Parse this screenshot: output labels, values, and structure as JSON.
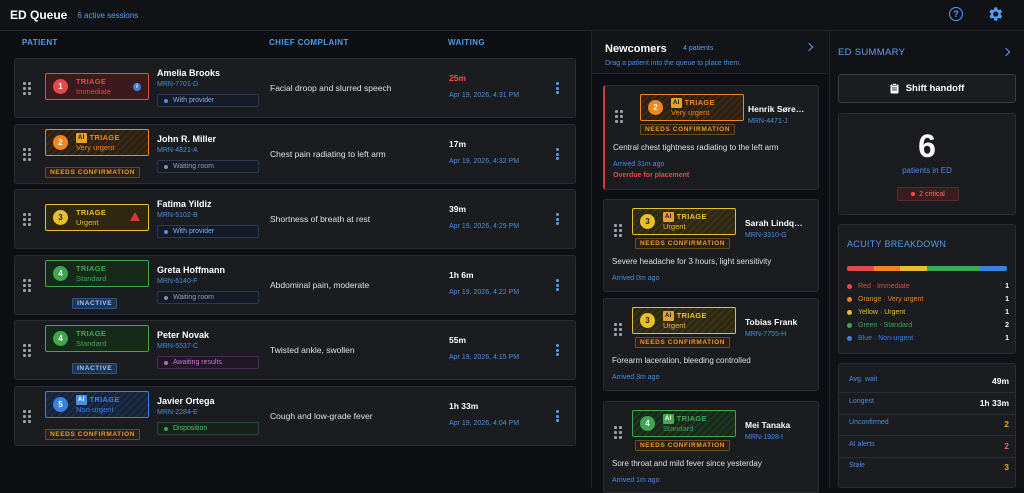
{
  "header": {
    "title": "ED Queue",
    "sessions": "6 active sessions"
  },
  "columns": {
    "patient": "PATIENT",
    "complaint": "CHIEF COMPLAINT",
    "waiting": "WAITING"
  },
  "queue": [
    {
      "triage_num": "1",
      "triage_label": "TRIAGE",
      "triage_level": "Immediate",
      "ai": false,
      "flag": "",
      "name": "Amelia Brooks",
      "mrn": "MRN-7701-D",
      "status": "With provider",
      "complaint": "Facial droop and slurred speech",
      "wait": "25m",
      "date": "Apr 19, 2026, 4:31 PM"
    },
    {
      "triage_num": "2",
      "triage_label": "TRIAGE",
      "triage_level": "Very urgent",
      "ai": true,
      "ai_text": "AI",
      "flag": "NEEDS CONFIRMATION",
      "name": "John R. Miller",
      "mrn": "MRN-4821-A",
      "status": "Waiting room",
      "complaint": "Chest pain radiating to left arm",
      "wait": "17m",
      "date": "Apr 19, 2026, 4:32 PM"
    },
    {
      "triage_num": "3",
      "triage_label": "TRIAGE",
      "triage_level": "Urgent",
      "ai": false,
      "flag": "",
      "name": "Fatima Yildiz",
      "mrn": "MRN-5102-B",
      "status": "With provider",
      "complaint": "Shortness of breath at rest",
      "wait": "39m",
      "date": "Apr 19, 2026, 4:29 PM"
    },
    {
      "triage_num": "4",
      "triage_label": "TRIAGE",
      "triage_level": "Standard",
      "ai": false,
      "flag": "INACTIVE",
      "name": "Greta Hoffmann",
      "mrn": "MRN-6140-F",
      "status": "Waiting room",
      "complaint": "Abdominal pain, moderate",
      "wait": "1h 6m",
      "date": "Apr 19, 2026, 4:22 PM"
    },
    {
      "triage_num": "4",
      "triage_label": "TRIAGE",
      "triage_level": "Standard",
      "ai": false,
      "flag": "INACTIVE",
      "name": "Peter Novak",
      "mrn": "MRN-5537-C",
      "status": "Awaiting results",
      "complaint": "Twisted ankle, swollen",
      "wait": "55m",
      "date": "Apr 19, 2026, 4:15 PM"
    },
    {
      "triage_num": "5",
      "triage_label": "TRIAGE",
      "triage_level": "Non-urgent",
      "ai": true,
      "ai_text": "AI",
      "flag": "NEEDS CONFIRMATION",
      "name": "Javier Ortega",
      "mrn": "MRN-2284-E",
      "status": "Disposition",
      "complaint": "Cough and low-grade fever",
      "wait": "1h 33m",
      "date": "Apr 19, 2026, 4:04 PM"
    }
  ],
  "newcomers": {
    "title": "Newcomers",
    "count": "4 patients",
    "subtitle": "Drag a patient into the queue to place them.",
    "items": [
      {
        "num": "2",
        "ai_text": "AI",
        "label": "TRIAGE",
        "level": "Very urgent",
        "flag": "NEEDS CONFIRMATION",
        "name": "Henrik Søre…",
        "mrn": "MRN-4471-J",
        "complaint": "Central chest tightness radiating to the left arm",
        "arrived": "Arrived 31m ago",
        "overdue": "Overdue for placement"
      },
      {
        "num": "3",
        "ai_text": "AI",
        "label": "TRIAGE",
        "level": "Urgent",
        "flag": "NEEDS CONFIRMATION",
        "name": "Sarah Lindq…",
        "mrn": "MRN-3310-G",
        "complaint": "Severe headache for 3 hours, light sensitivity",
        "arrived": "Arrived 0m ago"
      },
      {
        "num": "3",
        "ai_text": "AI",
        "label": "TRIAGE",
        "level": "Urgent",
        "flag": "NEEDS CONFIRMATION",
        "name": "Tobias Frank",
        "mrn": "MRN-7755-H",
        "complaint": "Forearm laceration, bleeding controlled",
        "arrived": "Arrived 3m ago"
      },
      {
        "num": "4",
        "ai_text": "AI",
        "label": "TRIAGE",
        "level": "Standard",
        "flag": "NEEDS CONFIRMATION",
        "name": "Mei Tanaka",
        "mrn": "MRN-1928-I",
        "complaint": "Sore throat and mild fever since yesterday",
        "arrived": "Arrived 1m ago"
      }
    ]
  },
  "summary": {
    "title": "ED SUMMARY",
    "handoff": "Shift handoff",
    "patients_count": "6",
    "patients_label": "patients in ED",
    "critical": "2 critical",
    "acuity_title": "ACUITY BREAKDOWN",
    "acuity": [
      {
        "label": "Red · Immediate",
        "count": "1",
        "color": "#e5484d"
      },
      {
        "label": "Orange · Very urgent",
        "count": "1",
        "color": "#f0861f"
      },
      {
        "label": "Yellow · Urgent",
        "count": "1",
        "color": "#e8c02c"
      },
      {
        "label": "Green · Standard",
        "count": "2",
        "color": "#3fa652"
      },
      {
        "label": "Blue · Non-urgent",
        "count": "1",
        "color": "#3b82e0"
      }
    ],
    "stats": [
      {
        "label": "Avg. wait",
        "value": "49m",
        "color": "#ffffff"
      },
      {
        "label": "Longest",
        "value": "1h 33m",
        "color": "#ffffff"
      },
      {
        "label": "Unconfirmed",
        "value": "2",
        "color": "#f0a030"
      },
      {
        "label": "AI alerts",
        "value": "2",
        "color": "#f06060"
      },
      {
        "label": "Stale",
        "value": "3",
        "color": "#f0a030"
      }
    ]
  },
  "colors": {
    "red": "#e5484d",
    "orange": "#f0861f",
    "yellow": "#e8c02c",
    "green": "#3fa652",
    "blue": "#3b82e0",
    "accent": "#4a8fe0"
  }
}
